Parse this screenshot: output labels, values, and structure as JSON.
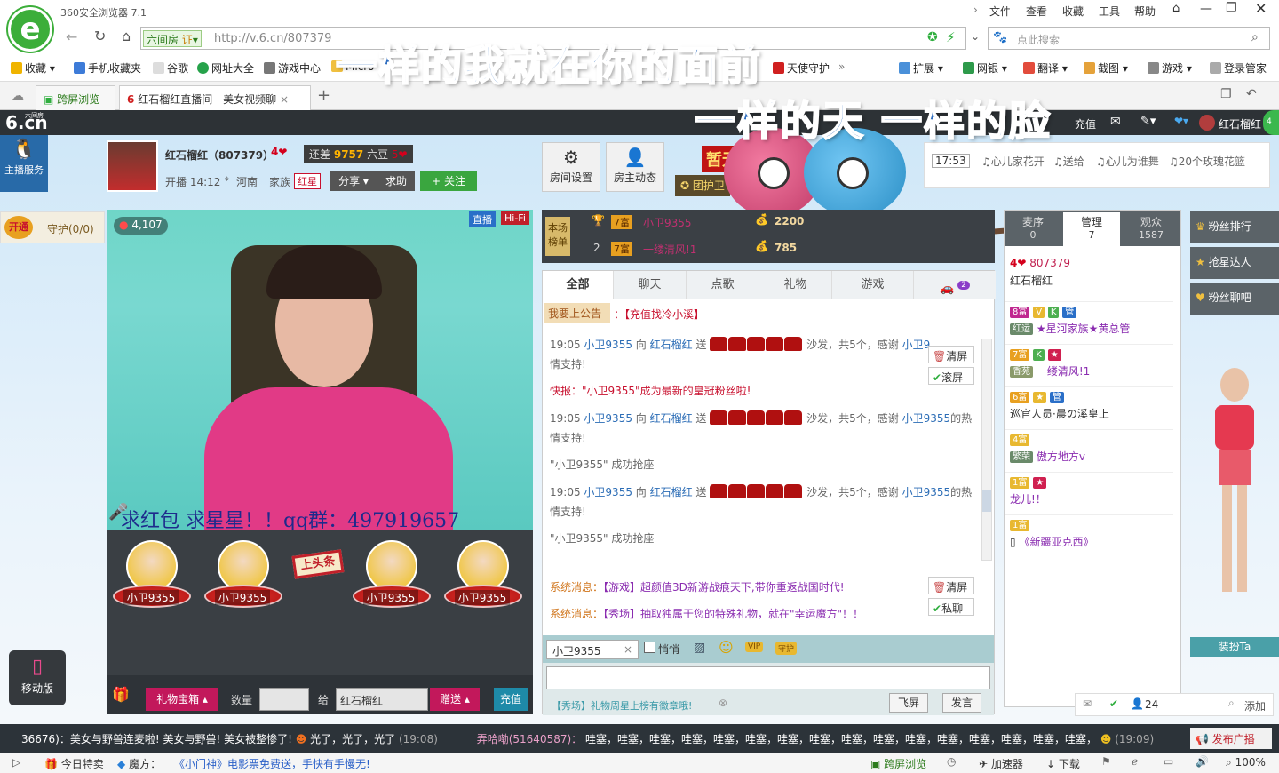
{
  "browser": {
    "title": "360安全浏览器 7.1",
    "menu": [
      "文件",
      "查看",
      "收藏",
      "工具",
      "帮助"
    ],
    "address_tag": "六间房",
    "address_cert": "证",
    "url": "http://v.6.cn/807379",
    "search_placeholder": "点此搜索",
    "favorites": [
      "收藏",
      "手机收藏夹",
      "谷歌",
      "网址大全",
      "游戏中心",
      "Micro",
      "天使守护"
    ],
    "right_tools": [
      "扩展",
      "网银",
      "翻译",
      "截图",
      "游戏",
      "登录管家"
    ],
    "tabs": [
      {
        "label": "跨屏浏览"
      },
      {
        "label": "红石榴红直播间 - 美女视频聊"
      }
    ],
    "overlay_line1": "一样的我就在你的面前",
    "overlay_line2": "一样的天 一样的脸"
  },
  "site": {
    "logo": "6.cn",
    "logo_small": "六间房",
    "recharge": "充值",
    "user_name": "红石榴红",
    "service": "主播服务"
  },
  "anchor": {
    "name": "红石榴红（807379）",
    "level": "4",
    "gap_label": "还差",
    "gap_value": "9757",
    "gap_unit": "六豆",
    "time": "开播 14:12",
    "location": "河南",
    "family_label": "家族",
    "family": "红星",
    "share": "分享",
    "help": "求助",
    "follow": "关注",
    "room_settings": "房间设置",
    "host_dynamics": "房主动态",
    "no_rank": "暂无",
    "guard_team": "团护卫"
  },
  "songs": {
    "time": "17:53",
    "items": [
      "♫心儿家花开",
      "♫送给",
      "♫心儿为谁舞",
      "♫20个玫瑰花篮"
    ]
  },
  "guard": {
    "open": "开通",
    "label": "守护(0/0)"
  },
  "video": {
    "wealth": "4,107",
    "live": "直播",
    "hifi": "Hi-Fi",
    "marquee": "求红包 求星星！！qq群：497919657"
  },
  "seats": {
    "names": [
      "小卫9355",
      "小卫9355",
      "小卫9355",
      "小卫9355"
    ],
    "headline": "上头条"
  },
  "giftbar": {
    "chest": "礼物宝箱",
    "qty": "数量",
    "to": "给",
    "target": "红石榴红",
    "send": "赠送",
    "recharge": "充值"
  },
  "ranking": {
    "label": "本场榜单",
    "rows": [
      {
        "rank": "",
        "lvl": "7富",
        "name": "小卫9355",
        "score": "2200"
      },
      {
        "rank": "2",
        "lvl": "7富",
        "name": "一缕清风!1",
        "score": "785"
      }
    ]
  },
  "chat": {
    "tabs": [
      "全部",
      "聊天",
      "点歌",
      "礼物",
      "游戏"
    ],
    "car_count": "2",
    "notice_btn": "我要上公告",
    "notice_text": "：【充值找冷小溪】",
    "clear": "清屏",
    "scroll": "滚屏",
    "private": "私聊",
    "messages": [
      {
        "time": "19:05",
        "from": "小卫9355",
        "mid": "向",
        "to": "红石榴红",
        "act": "送",
        "tail": "沙发，共5个，感谢",
        "thanks": "小卫9",
        "end": "情支持!"
      },
      {
        "flash": "快报：\"小卫9355\"成为最新的皇冠粉丝啦!"
      },
      {
        "time": "19:05",
        "from": "小卫9355",
        "mid": "向",
        "to": "红石榴红",
        "act": "送",
        "tail": "沙发，共5个，感谢",
        "thanks": "小卫9355",
        "thanks2": "的热",
        "end": "情支持!"
      },
      {
        "plain": "\"小卫9355\" 成功抢座"
      },
      {
        "time": "19:05",
        "from": "小卫9355",
        "mid": "向",
        "to": "红石榴红",
        "act": "送",
        "tail": "沙发，共5个，感谢",
        "thanks": "小卫9355",
        "thanks2": "的热",
        "end": "情支持!"
      },
      {
        "plain": "\"小卫9355\" 成功抢座"
      }
    ],
    "system": [
      {
        "label": "系统消息：",
        "text": "【游戏】超颜值3D新游战痕天下,带你重返战国时代!"
      },
      {
        "label": "系统消息：",
        "text": "【秀场】抽取独属于您的特殊礼物，就在\"幸运魔方\"！！"
      }
    ],
    "target": "小卫9355",
    "quiet": "悄悄",
    "vip": "VIP",
    "guard": "守护",
    "hint": "【秀场】礼物周星上榜有徽章哦!",
    "fly": "飞屏",
    "send": "发言"
  },
  "users": {
    "tabs": [
      {
        "label": "麦序",
        "count": "0"
      },
      {
        "label": "管理",
        "count": "7"
      },
      {
        "label": "观众",
        "count": "1587"
      }
    ],
    "list": [
      {
        "level": "4",
        "id": "807379",
        "name": "红石榴红"
      },
      {
        "lvl": "8富",
        "tag": "红运",
        "name": "★星河家族★黄总管"
      },
      {
        "lvl": "7富",
        "tag": "香苑",
        "name": "一缕清风!1"
      },
      {
        "lvl": "6富",
        "name": "巡官人员·晨の溪皇上"
      },
      {
        "lvl": "4富",
        "tag": "繁荣",
        "name": "傲方地方v"
      },
      {
        "lvl": "1富",
        "name": "龙儿!！"
      },
      {
        "lvl": "1富",
        "name": "《新疆亚克西》"
      }
    ],
    "count": "24",
    "add": "添加"
  },
  "sidebar": {
    "items": [
      "粉丝排行",
      "抢星达人",
      "粉丝聊吧"
    ],
    "dress": "装扮Ta"
  },
  "mobile": "移动版",
  "ticker": {
    "text1": "36676)：美女与野兽连麦啦! 美女与野兽! 美女被整惨了!",
    "text1b": "光了，光了，光了",
    "time1": "(19:08)",
    "user2": "弄哈嘞(51640587)：",
    "text2": "哇塞，哇塞，哇塞，哇塞，哇塞，哇塞，哇塞，哇塞，哇塞，哇塞，哇塞，哇塞，哇塞，哇塞，哇塞，哇塞，",
    "time2": "(19:09)",
    "broadcast": "发布广播"
  },
  "status": {
    "sale": "今日特卖",
    "magic": "魔方：",
    "news": "《小门神》电影票免费送，手快有手慢无!",
    "cross": "跨屏浏览",
    "accel": "加速器",
    "download": "下载",
    "zoom": "100%"
  }
}
